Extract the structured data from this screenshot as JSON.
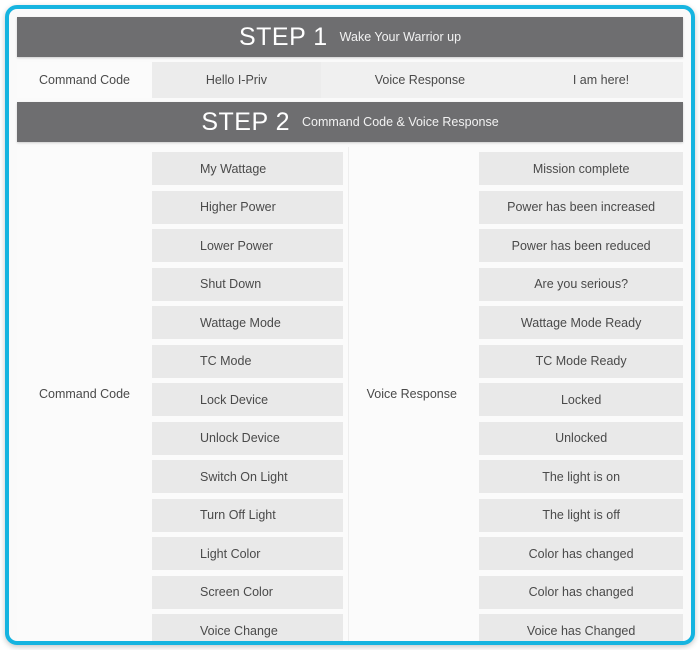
{
  "theme": {
    "border_color": "#16b4e0",
    "header_bar_color": "#6e6e70",
    "pill_color": "#e9e9e9",
    "text_color": "#4a4a4a"
  },
  "step1": {
    "title": "STEP 1",
    "subtitle": "Wake Your Warrior up",
    "command_label": "Command Code",
    "command_value": "Hello I-Priv",
    "response_label": "Voice Response",
    "response_value": "I am here!"
  },
  "step2": {
    "title": "STEP 2",
    "subtitle": "Command Code & Voice Response",
    "command_label": "Command Code",
    "response_label": "Voice Response",
    "rows": [
      {
        "command": "My Wattage",
        "response": "Mission complete"
      },
      {
        "command": "Higher Power",
        "response": "Power has been increased"
      },
      {
        "command": "Lower Power",
        "response": "Power has been reduced"
      },
      {
        "command": "Shut Down",
        "response": "Are you serious?"
      },
      {
        "command": "Wattage Mode",
        "response": "Wattage Mode Ready"
      },
      {
        "command": "TC Mode",
        "response": "TC Mode Ready"
      },
      {
        "command": "Lock Device",
        "response": "Locked"
      },
      {
        "command": "Unlock Device",
        "response": "Unlocked"
      },
      {
        "command": "Switch On Light",
        "response": "The light is on"
      },
      {
        "command": "Turn Off Light",
        "response": "The light is off"
      },
      {
        "command": "Light Color",
        "response": "Color has changed"
      },
      {
        "command": "Screen Color",
        "response": "Color has changed"
      },
      {
        "command": "Voice Change",
        "response": "Voice has Changed"
      }
    ]
  }
}
